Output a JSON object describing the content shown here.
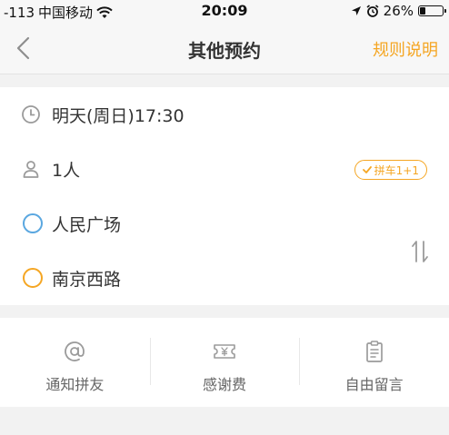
{
  "status_bar": {
    "signal": "-113",
    "carrier": "中国移动",
    "time": "20:09",
    "battery": "26%",
    "battery_level": 0.26
  },
  "nav": {
    "title": "其他预约",
    "rule_label": "规则说明",
    "back_icon": "chevron-left-icon"
  },
  "trip": {
    "time": "明天(周日)17:30",
    "passengers": "1人",
    "carpool_badge": "拼车1+1",
    "origin": "人民广场",
    "destination": "南京西路"
  },
  "actions": [
    {
      "label": "通知拼友",
      "icon": "at-icon"
    },
    {
      "label": "感谢费",
      "icon": "yen-ticket-icon"
    },
    {
      "label": "自由留言",
      "icon": "clipboard-icon"
    }
  ],
  "colors": {
    "accent": "#f5a623",
    "origin_dot": "#5aa7e0",
    "destination_dot": "#f5a623",
    "icon_gray": "#9b9b9b"
  }
}
